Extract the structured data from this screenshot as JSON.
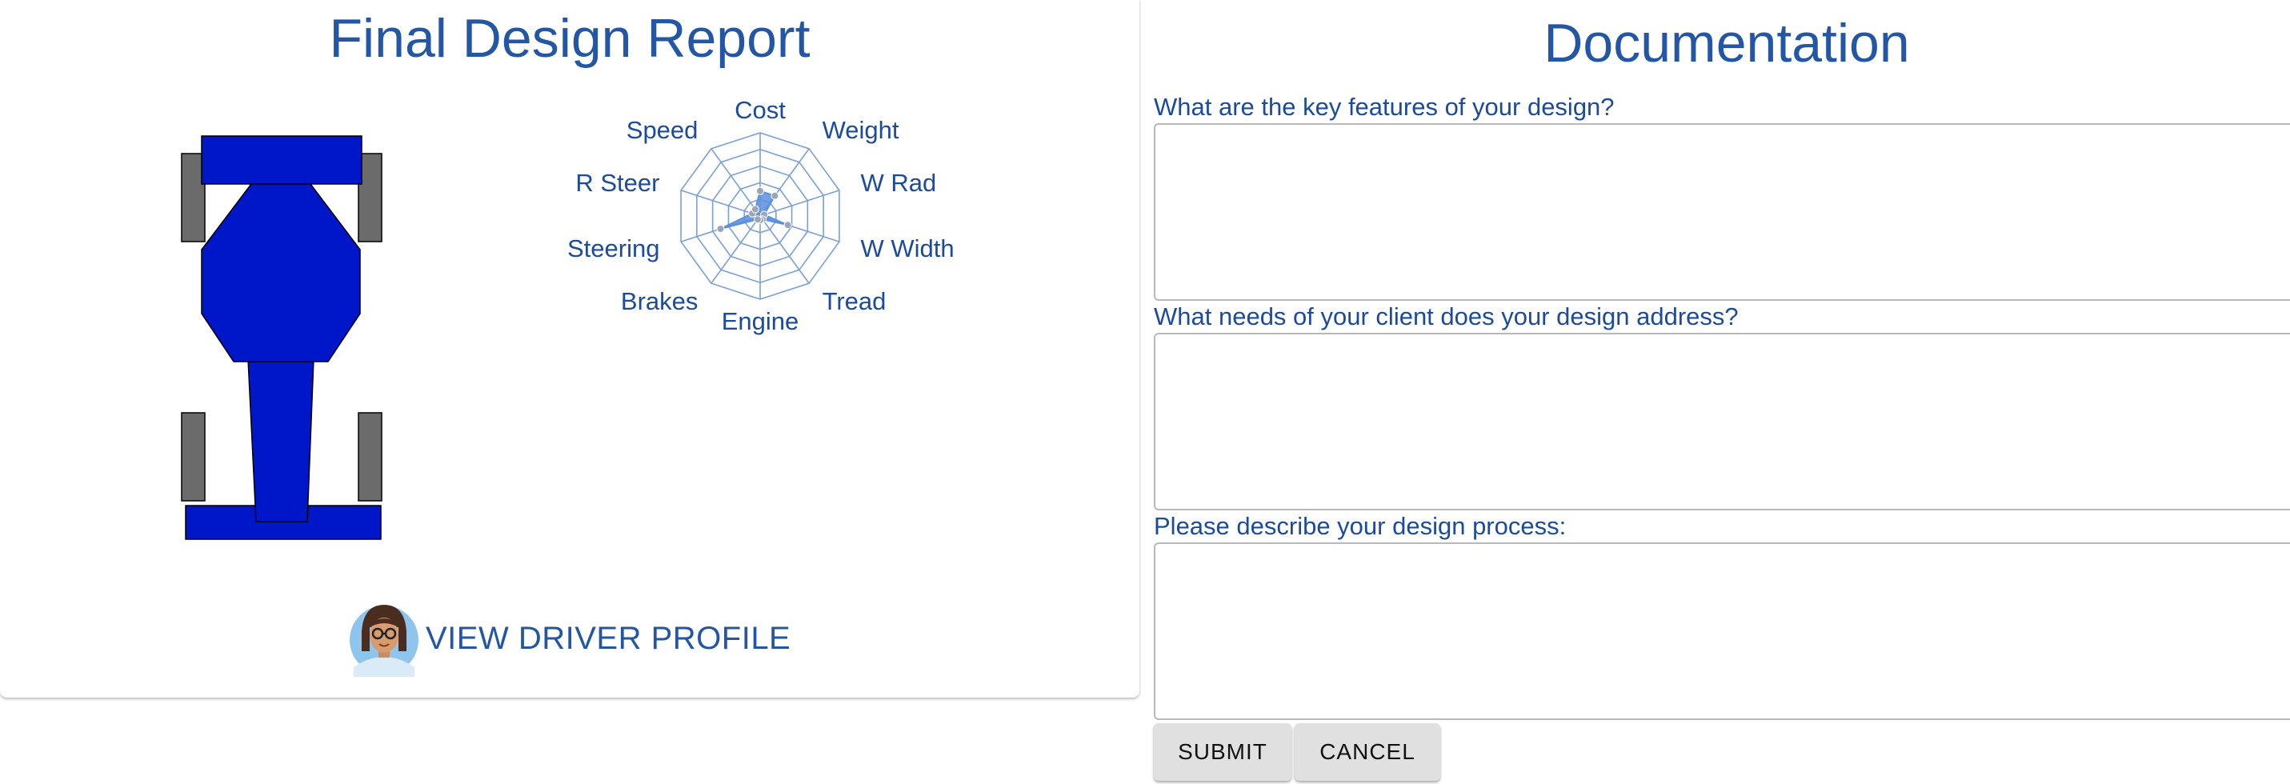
{
  "report": {
    "title": "Final Design Report",
    "driver_button_label": "VIEW DRIVER PROFILE"
  },
  "car": {
    "body_color": "#0016c9",
    "wheel_color": "#6b6b6b"
  },
  "radar": {
    "labels": [
      "Cost",
      "Weight",
      "W Rad",
      "W Width",
      "Tread",
      "Engine",
      "Brakes",
      "Steering",
      "R Steer",
      "Speed"
    ],
    "values": [
      0.3,
      0.3,
      0.05,
      0.35,
      0.05,
      0.05,
      0.05,
      0.5,
      0.1,
      0.1
    ],
    "levels": 5,
    "grid_color": "#7aa0d8",
    "fill_color": "#5b8fe0",
    "label_color": "#1c4b9c"
  },
  "documentation": {
    "title": "Documentation",
    "questions": [
      {
        "label": "What are the key features of your design?",
        "value": ""
      },
      {
        "label": "What needs of your client does your design address?",
        "value": ""
      },
      {
        "label": "Please describe your design process:",
        "value": ""
      }
    ],
    "submit_label": "SUBMIT",
    "cancel_label": "CANCEL"
  }
}
